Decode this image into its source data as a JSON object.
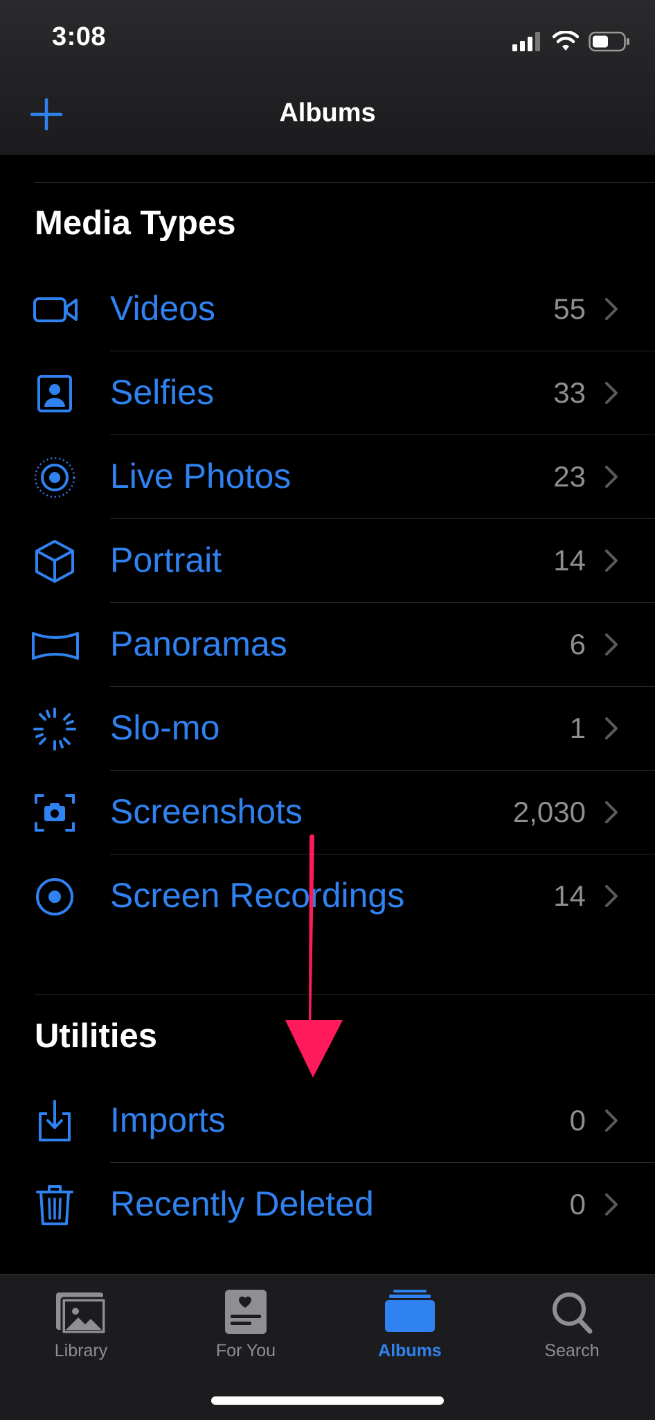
{
  "status_bar": {
    "time": "3:08"
  },
  "nav": {
    "title": "Albums"
  },
  "sections": {
    "media_types": {
      "title": "Media Types",
      "items": [
        {
          "label": "Videos",
          "count": "55",
          "icon": "video-icon"
        },
        {
          "label": "Selfies",
          "count": "33",
          "icon": "selfie-icon"
        },
        {
          "label": "Live Photos",
          "count": "23",
          "icon": "live-photo-icon"
        },
        {
          "label": "Portrait",
          "count": "14",
          "icon": "cube-icon"
        },
        {
          "label": "Panoramas",
          "count": "6",
          "icon": "panorama-icon"
        },
        {
          "label": "Slo-mo",
          "count": "1",
          "icon": "slomo-icon"
        },
        {
          "label": "Screenshots",
          "count": "2,030",
          "icon": "screenshot-icon"
        },
        {
          "label": "Screen Recordings",
          "count": "14",
          "icon": "screen-recording-icon"
        }
      ]
    },
    "utilities": {
      "title": "Utilities",
      "items": [
        {
          "label": "Imports",
          "count": "0",
          "icon": "import-icon"
        },
        {
          "label": "Recently Deleted",
          "count": "0",
          "icon": "trash-icon"
        }
      ]
    }
  },
  "tabbar": {
    "tabs": [
      {
        "label": "Library",
        "icon": "library-icon",
        "active": false
      },
      {
        "label": "For You",
        "icon": "for-you-icon",
        "active": false
      },
      {
        "label": "Albums",
        "icon": "albums-icon",
        "active": true
      },
      {
        "label": "Search",
        "icon": "search-icon",
        "active": false
      }
    ]
  },
  "colors": {
    "accent": "#2f82f0",
    "secondary_text": "#8e8e93",
    "annotation_arrow": "#ff1a5b",
    "background": "#000000"
  }
}
